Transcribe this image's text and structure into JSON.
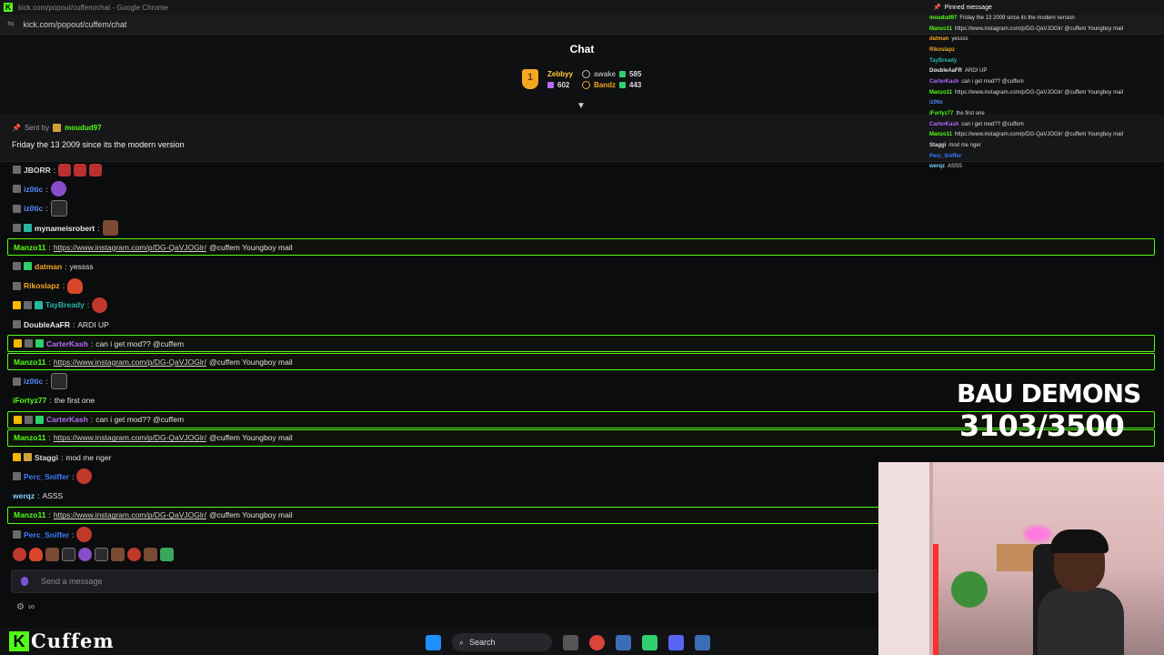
{
  "browser": {
    "title": "kick.com/popout/cuffem/chat - Google Chrome",
    "url": "kick.com/popout/cuffem/chat"
  },
  "chat": {
    "title": "Chat",
    "leaderboard": [
      {
        "name": "Zebbyy",
        "count": "602",
        "color": "#ffcc33"
      },
      {
        "name": "awake",
        "count": "585",
        "color": "#aaaaaa"
      },
      {
        "name": "Bandz",
        "count": "443",
        "color": "#f5a623"
      }
    ],
    "pinned": {
      "sent_by_label": "Sent by",
      "sender": "moudud97",
      "message": "Friday the 13 2009 since its the modern version"
    },
    "input_placeholder": "Send a message",
    "tools": "∞"
  },
  "messages": [
    {
      "user": "JBORR",
      "color": "#d9d9d9",
      "badges": [
        "avatar"
      ],
      "text": "",
      "emotes": [
        "w",
        "w",
        "w"
      ],
      "hl": false
    },
    {
      "user": "iz0tic",
      "color": "#5b8bff",
      "badges": [
        "avatar"
      ],
      "text": "",
      "emotes": [
        "purple"
      ],
      "hl": false
    },
    {
      "user": "iz0tic",
      "color": "#5b8bff",
      "badges": [
        "avatar"
      ],
      "text": "",
      "emotes": [
        "bau"
      ],
      "hl": false
    },
    {
      "user": "mynameisrobert",
      "color": "#e8e8e8",
      "badges": [
        "avatar",
        "vip"
      ],
      "text": "",
      "emotes": [
        "brown"
      ],
      "hl": false
    },
    {
      "user": "Manzo11",
      "color": "#53fc18",
      "badges": [],
      "link": "https://www.instagram.com/p/DG-QaVJOGlr/",
      "text": " @cuffem Youngboy mail",
      "emotes": [],
      "hl": true
    },
    {
      "user": "datman",
      "color": "#f5a623",
      "badges": [
        "avatar",
        "sub"
      ],
      "text": " yessss",
      "emotes": [],
      "hl": false
    },
    {
      "user": "Rikoslapz",
      "color": "#f5a623",
      "badges": [
        "avatar"
      ],
      "text": "",
      "emotes": [
        "fire"
      ],
      "hl": false
    },
    {
      "user": "TayBready",
      "color": "#29b7a4",
      "badges": [
        "crown",
        "avatar",
        "vip"
      ],
      "text": "",
      "emotes": [
        "red"
      ],
      "hl": false
    },
    {
      "user": "DoubleAaFR",
      "color": "#e8e8e8",
      "badges": [
        "avatar"
      ],
      "text": " ARDI UP",
      "emotes": [],
      "hl": false
    },
    {
      "user": "CarterKash",
      "color": "#b46cff",
      "badges": [
        "crown",
        "avatar",
        "sub"
      ],
      "text": " can i get mod?? @cuffem",
      "emotes": [],
      "hl": true
    },
    {
      "user": "Manzo11",
      "color": "#53fc18",
      "badges": [],
      "link": "https://www.instagram.com/p/DG-QaVJOGlr/",
      "text": " @cuffem Youngboy mail",
      "emotes": [],
      "hl": true
    },
    {
      "user": "iz0tic",
      "color": "#5b8bff",
      "badges": [
        "avatar"
      ],
      "text": "",
      "emotes": [
        "bau"
      ],
      "hl": false
    },
    {
      "user": "iFortyz77",
      "color": "#53fc18",
      "badges": [],
      "text": " the first one",
      "emotes": [],
      "hl": false
    },
    {
      "user": "CarterKash",
      "color": "#b46cff",
      "badges": [
        "crown",
        "avatar",
        "sub"
      ],
      "text": " can i get mod?? @cuffem",
      "emotes": [],
      "hl": true
    },
    {
      "user": "Manzo11",
      "color": "#53fc18",
      "badges": [],
      "link": "https://www.instagram.com/p/DG-QaVJOGlr/",
      "text": " @cuffem Youngboy mail",
      "emotes": [],
      "hl": true
    },
    {
      "user": "Staggi",
      "color": "#d9d9d9",
      "badges": [
        "crown",
        "gold"
      ],
      "text": " mod me nger",
      "emotes": [],
      "hl": false
    },
    {
      "user": "Perc_Sniffer",
      "color": "#3c7dff",
      "badges": [
        "avatar"
      ],
      "text": "",
      "emotes": [
        "red"
      ],
      "hl": false
    },
    {
      "user": "werqz",
      "color": "#7fd1ff",
      "badges": [],
      "text": " ASSS",
      "emotes": [],
      "hl": false
    },
    {
      "user": "Manzo11",
      "color": "#53fc18",
      "badges": [],
      "link": "https://www.instagram.com/p/DG-QaVJOGlr/",
      "text": " @cuffem Youngboy mail",
      "emotes": [],
      "hl": true
    },
    {
      "user": "Perc_Sniffer",
      "color": "#3c7dff",
      "badges": [
        "avatar"
      ],
      "text": "",
      "emotes": [
        "red"
      ],
      "hl": false
    }
  ],
  "emote_bar": [
    "red",
    "fire",
    "brown",
    "bau",
    "purple",
    "bau",
    "brown",
    "red",
    "brown",
    "green"
  ],
  "overlay": {
    "pinned_label": "Pinned message",
    "rows": [
      {
        "user": "moudud97",
        "color": "#53fc18",
        "text": "Friday the 13 2009 since its the modern version"
      },
      {
        "user": "Manzo11",
        "color": "#53fc18",
        "text": "https://www.instagram.com/p/DG-QaVJOGlr/ @cuffem Youngboy mail"
      },
      {
        "user": "datman",
        "color": "#f5a623",
        "text": "yessss"
      },
      {
        "user": "Rikoslapz",
        "color": "#f5a623",
        "text": ""
      },
      {
        "user": "TayBready",
        "color": "#29b7a4",
        "text": ""
      },
      {
        "user": "DoubleAaFR",
        "color": "#e8e8e8",
        "text": "ARDI UP"
      },
      {
        "user": "CarterKash",
        "color": "#b46cff",
        "text": "can i get mod?? @cuffem"
      },
      {
        "user": "Manzo11",
        "color": "#53fc18",
        "text": "https://www.instagram.com/p/DG-QaVJOGlr/ @cuffem Youngboy mail"
      },
      {
        "user": "iz0tic",
        "color": "#5b8bff",
        "text": ""
      },
      {
        "user": "iFortyz77",
        "color": "#53fc18",
        "text": "the first one"
      },
      {
        "user": "CarterKash",
        "color": "#b46cff",
        "text": "can i get mod?? @cuffem"
      },
      {
        "user": "Manzo11",
        "color": "#53fc18",
        "text": "https://www.instagram.com/p/DG-QaVJOGlr/ @cuffem Youngboy mail"
      },
      {
        "user": "Staggi",
        "color": "#d9d9d9",
        "text": "mod me nger"
      },
      {
        "user": "Perc_Sniffer",
        "color": "#3c7dff",
        "text": ""
      },
      {
        "user": "werqz",
        "color": "#7fd1ff",
        "text": "ASSS"
      }
    ]
  },
  "goal": {
    "label": "BAU DEMONS",
    "progress": "3103/3500"
  },
  "stream": {
    "channel_name": "Cuffem",
    "logo_letter": "K"
  },
  "taskbar": {
    "search_label": "Search"
  },
  "colors": {
    "kick_green": "#53fc18",
    "background": "#0b0c0e"
  }
}
